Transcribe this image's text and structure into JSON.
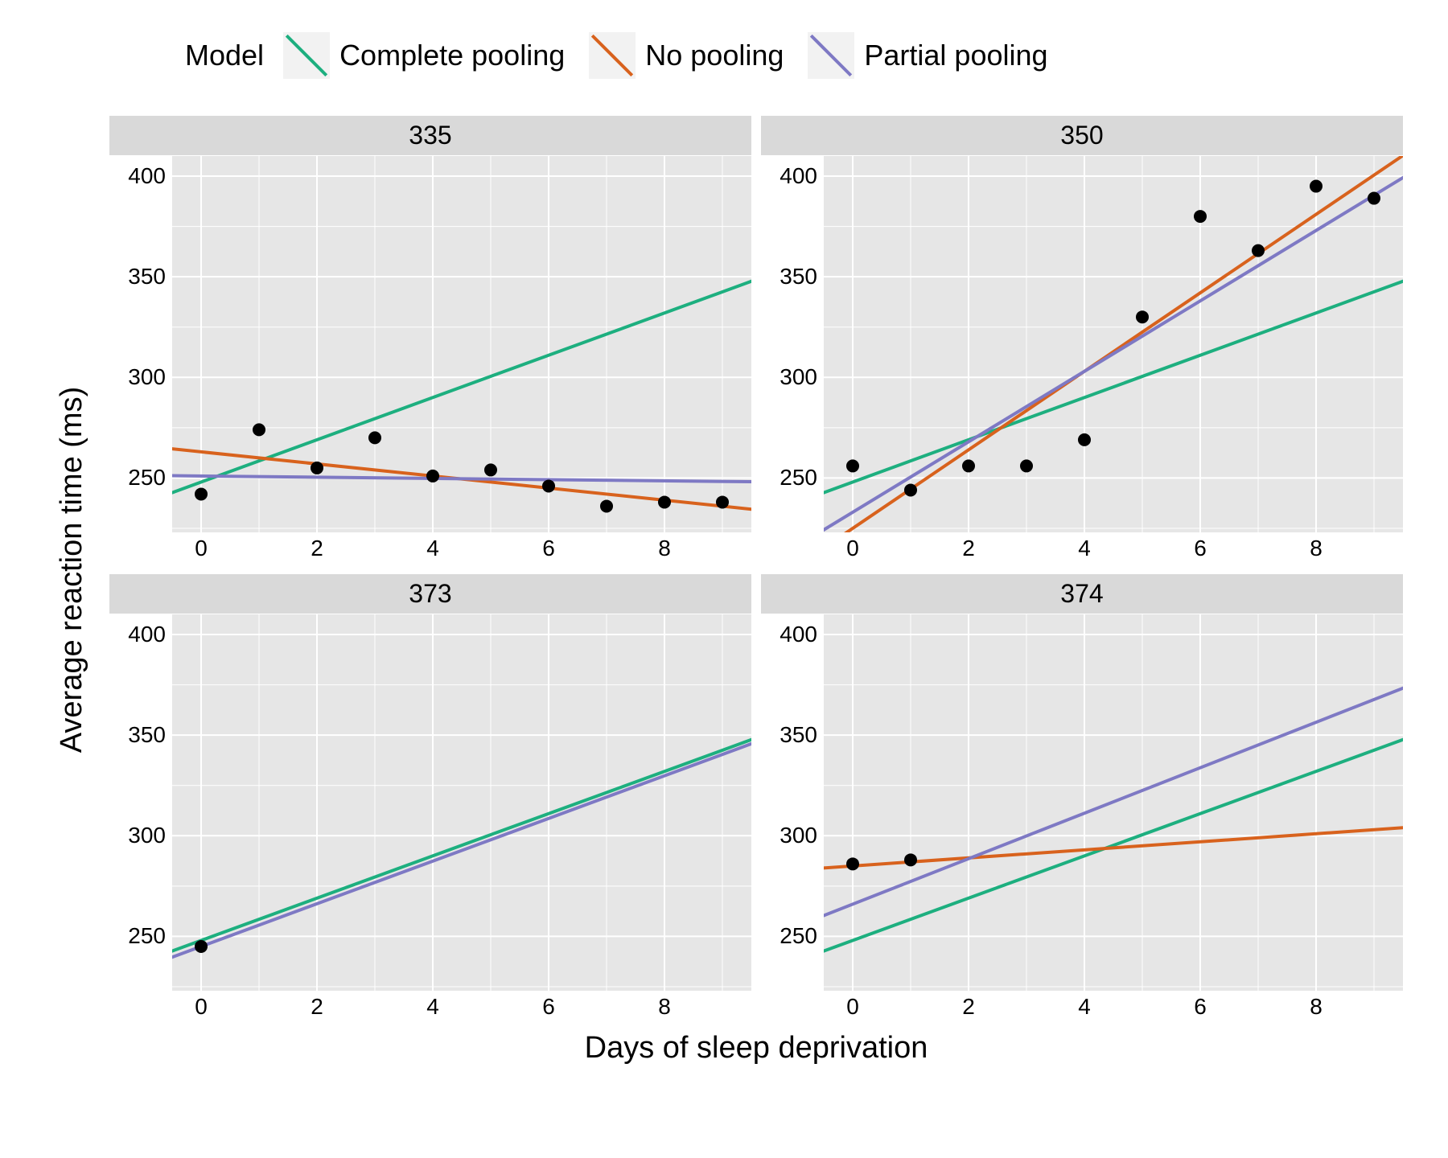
{
  "legend_title": "Model",
  "xlabel": "Days of sleep deprivation",
  "ylabel": "Average reaction time (ms)",
  "models": [
    {
      "name": "Complete pooling",
      "color": "#1DAF7F"
    },
    {
      "name": "No pooling",
      "color": "#D8621D"
    },
    {
      "name": "Partial pooling",
      "color": "#7E79C4"
    }
  ],
  "chart_data": {
    "type": "scatter",
    "xlim": [
      -0.5,
      9.5
    ],
    "ylim": [
      223,
      410
    ],
    "xticks": [
      0,
      2,
      4,
      6,
      8
    ],
    "yticks": [
      250,
      300,
      350,
      400
    ],
    "panels": [
      {
        "label": "335",
        "points": [
          {
            "x": 0,
            "y": 242
          },
          {
            "x": 1,
            "y": 274
          },
          {
            "x": 2,
            "y": 255
          },
          {
            "x": 3,
            "y": 270
          },
          {
            "x": 4,
            "y": 251
          },
          {
            "x": 5,
            "y": 254
          },
          {
            "x": 6,
            "y": 246
          },
          {
            "x": 7,
            "y": 236
          },
          {
            "x": 8,
            "y": 238
          },
          {
            "x": 9,
            "y": 238
          }
        ],
        "lines": {
          "complete": {
            "intercept": 248,
            "slope": 10.5
          },
          "nopool": {
            "intercept": 263,
            "slope": -3.0
          },
          "partial": {
            "intercept": 251,
            "slope": -0.3
          }
        }
      },
      {
        "label": "350",
        "points": [
          {
            "x": 0,
            "y": 256
          },
          {
            "x": 1,
            "y": 244
          },
          {
            "x": 2,
            "y": 256
          },
          {
            "x": 3,
            "y": 256
          },
          {
            "x": 4,
            "y": 269
          },
          {
            "x": 5,
            "y": 330
          },
          {
            "x": 6,
            "y": 380
          },
          {
            "x": 7,
            "y": 363
          },
          {
            "x": 8,
            "y": 395
          },
          {
            "x": 9,
            "y": 389
          }
        ],
        "lines": {
          "complete": {
            "intercept": 248,
            "slope": 10.5
          },
          "nopool": {
            "intercept": 225,
            "slope": 19.5
          },
          "partial": {
            "intercept": 233,
            "slope": 17.5
          }
        }
      },
      {
        "label": "373",
        "points": [
          {
            "x": 0,
            "y": 245
          }
        ],
        "lines": {
          "complete": {
            "intercept": 248,
            "slope": 10.5
          },
          "nopool": null,
          "partial": {
            "intercept": 245,
            "slope": 10.6
          }
        }
      },
      {
        "label": "374",
        "points": [
          {
            "x": 0,
            "y": 286
          },
          {
            "x": 1,
            "y": 288
          }
        ],
        "lines": {
          "complete": {
            "intercept": 248,
            "slope": 10.5
          },
          "nopool": {
            "intercept": 285,
            "slope": 2.0
          },
          "partial": {
            "intercept": 266,
            "slope": 11.3
          }
        }
      }
    ]
  }
}
